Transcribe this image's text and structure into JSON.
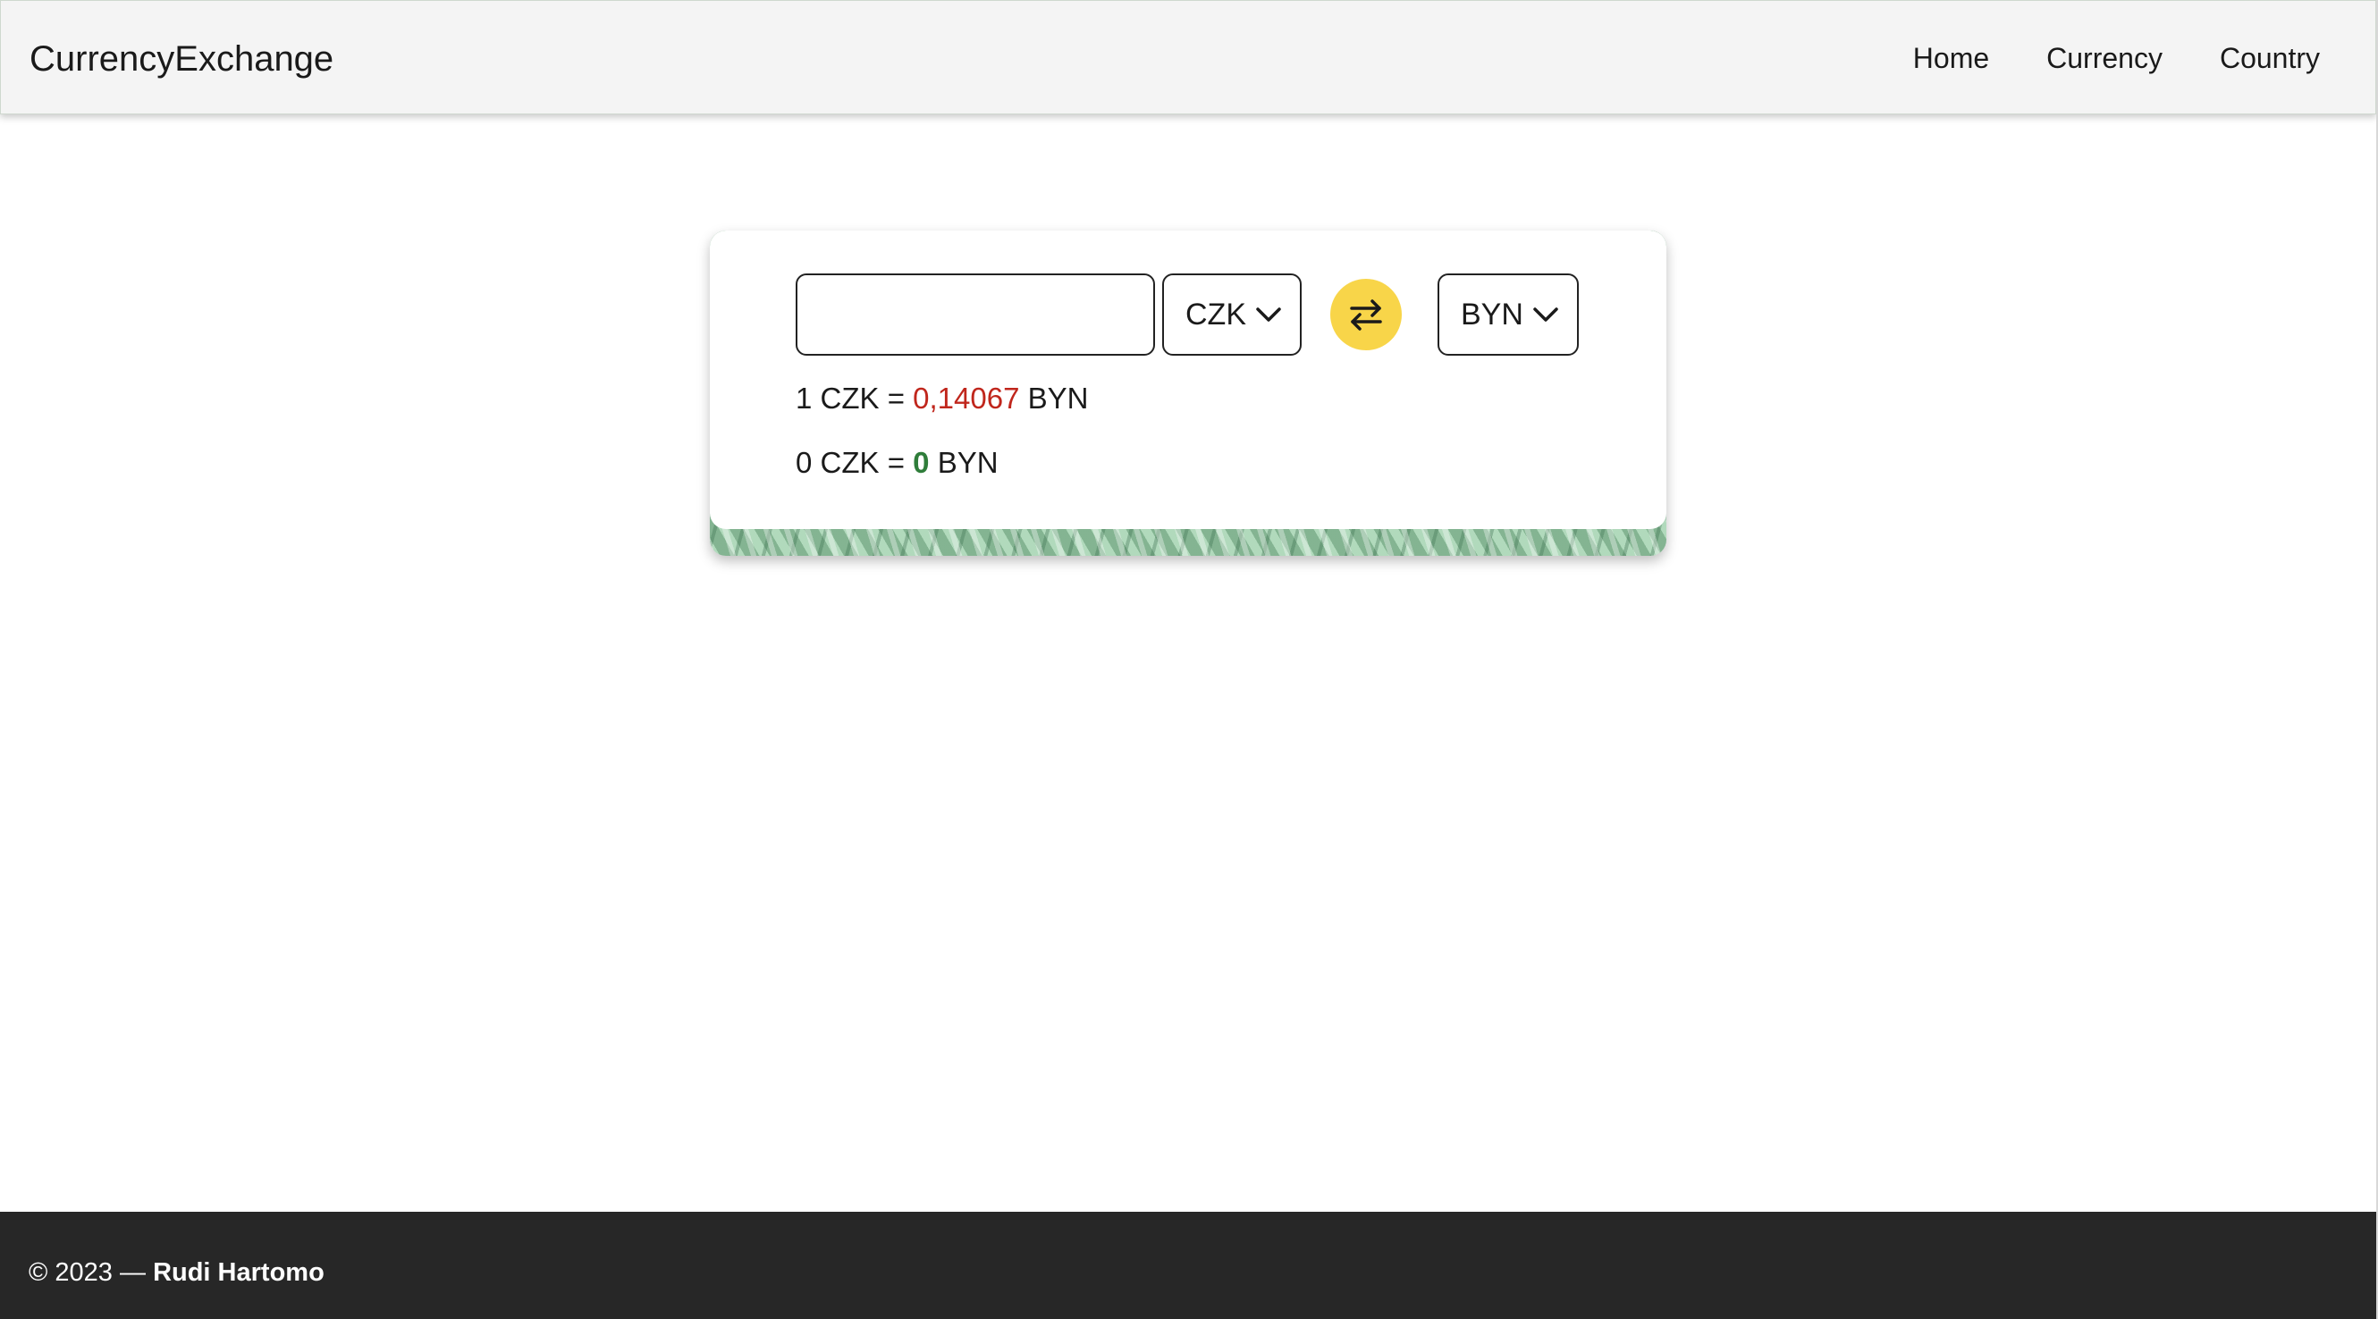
{
  "navbar": {
    "brand": "CurrencyExchange",
    "links": [
      "Home",
      "Currency",
      "Country"
    ]
  },
  "converter": {
    "amount_value": "",
    "from_currency": "CZK",
    "to_currency": "BYN",
    "rate_line": {
      "amount": "1",
      "from": "CZK",
      "equals": "=",
      "value": "0,14067",
      "to": "BYN"
    },
    "result_line": {
      "amount": "0",
      "from": "CZK",
      "equals": "=",
      "value": "0",
      "to": "BYN"
    },
    "colors": {
      "swap_button": "#f8d549",
      "rate_value": "#c0261c",
      "result_value": "#2f7d3a"
    }
  },
  "footer": {
    "copyright": "© 2023 —",
    "author": "Rudi Hartomo"
  }
}
